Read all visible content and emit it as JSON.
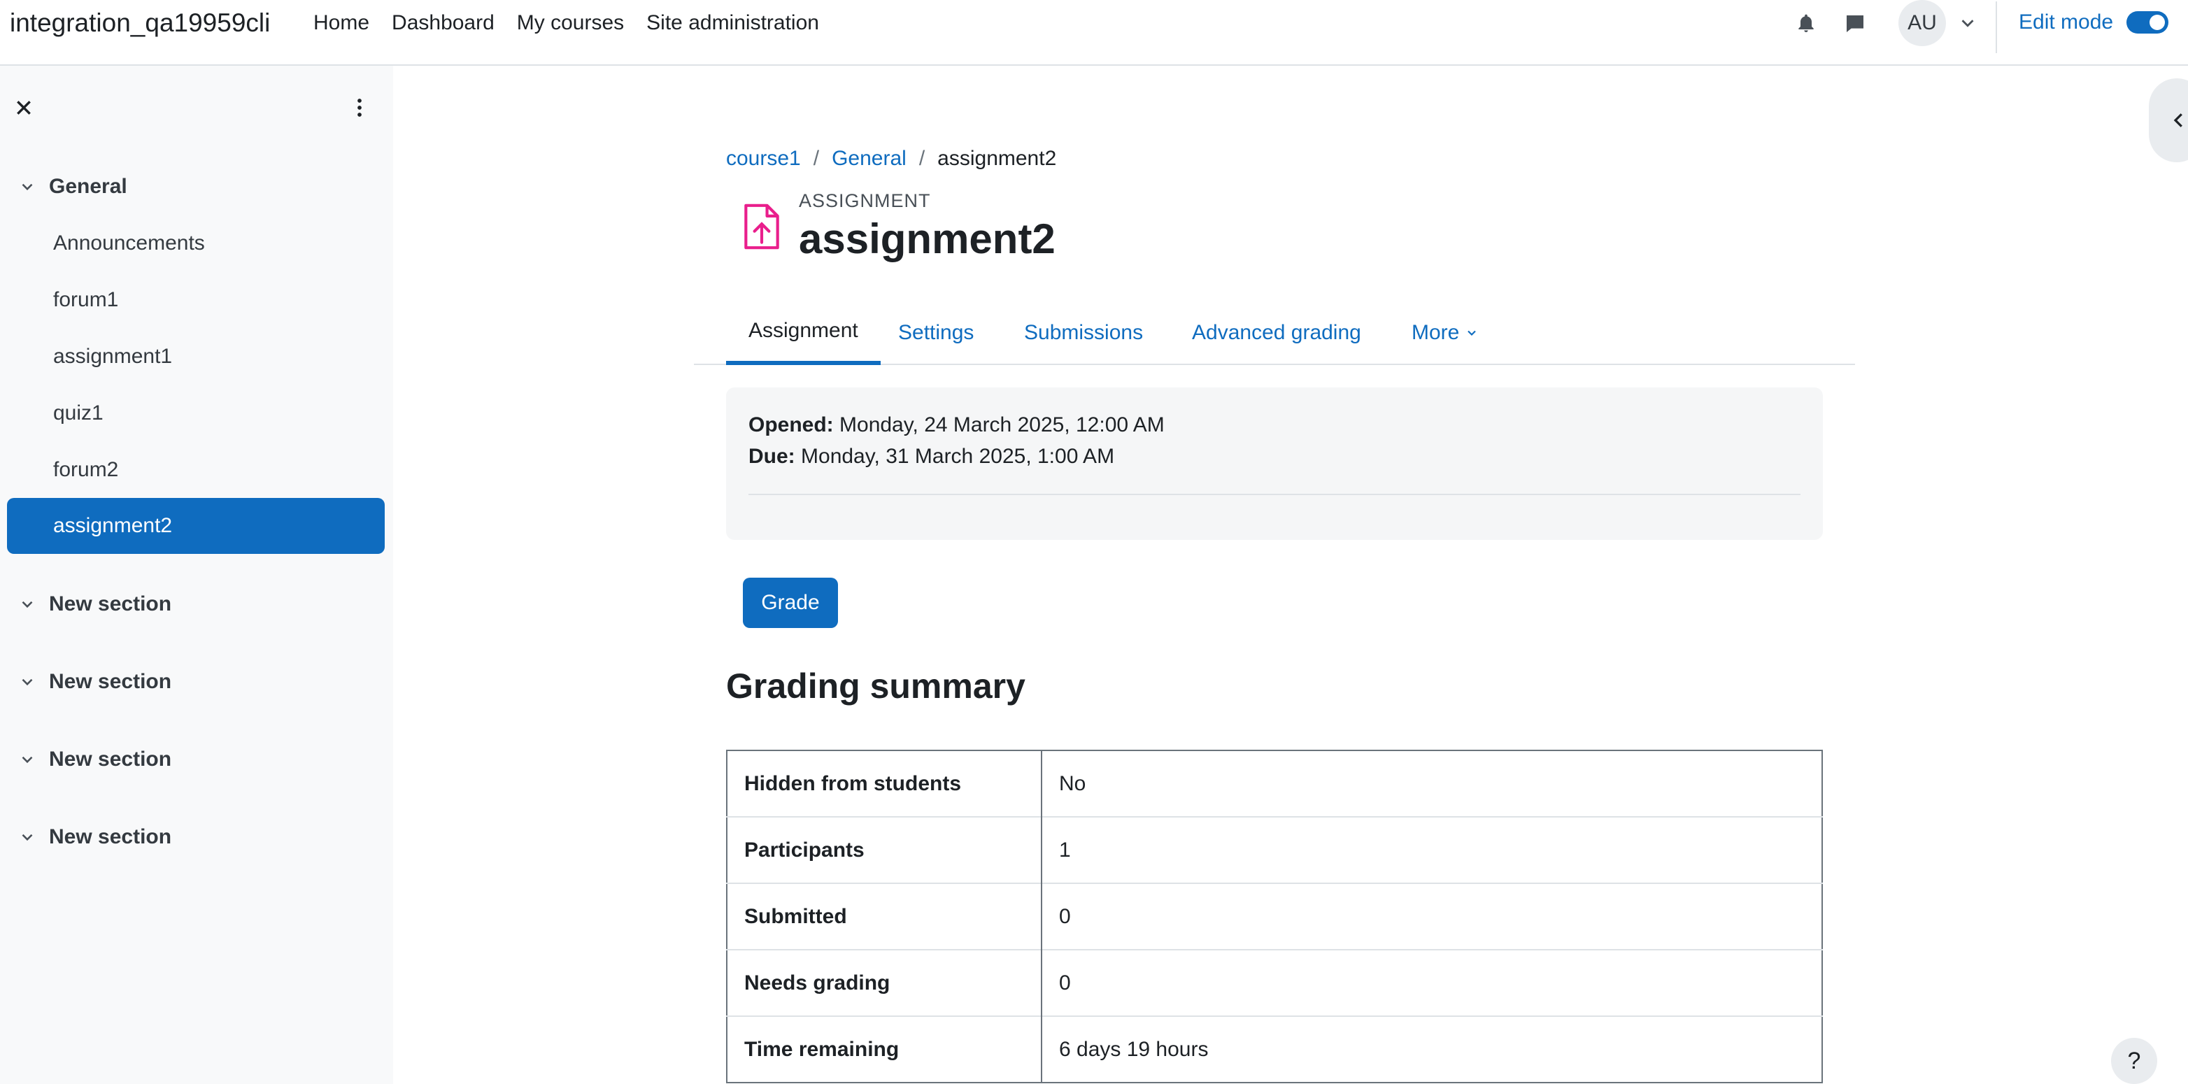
{
  "header": {
    "site_name": "integration_qa19959cli",
    "nav": [
      "Home",
      "Dashboard",
      "My courses",
      "Site administration"
    ],
    "avatar_initials": "AU",
    "edit_mode_label": "Edit mode",
    "edit_mode_on": true
  },
  "drawer": {
    "sections": [
      {
        "title": "General",
        "items": [
          "Announcements",
          "forum1",
          "assignment1",
          "quiz1",
          "forum2",
          "assignment2"
        ],
        "active_item": "assignment2"
      },
      {
        "title": "New section"
      },
      {
        "title": "New section"
      },
      {
        "title": "New section"
      },
      {
        "title": "New section"
      }
    ]
  },
  "breadcrumb": {
    "items": [
      "course1",
      "General"
    ],
    "current": "assignment2"
  },
  "activity": {
    "type_label": "ASSIGNMENT",
    "title": "assignment2"
  },
  "tabs": {
    "items": [
      "Assignment",
      "Settings",
      "Submissions",
      "Advanced grading",
      "More"
    ],
    "active": "Assignment"
  },
  "dates": {
    "opened_label": "Opened:",
    "opened_value": "Monday, 24 March 2025, 12:00 AM",
    "due_label": "Due:",
    "due_value": "Monday, 31 March 2025, 1:00 AM"
  },
  "grade_button": "Grade",
  "grading_summary": {
    "title": "Grading summary",
    "rows": [
      {
        "label": "Hidden from students",
        "value": "No"
      },
      {
        "label": "Participants",
        "value": "1"
      },
      {
        "label": "Submitted",
        "value": "0"
      },
      {
        "label": "Needs grading",
        "value": "0"
      },
      {
        "label": "Time remaining",
        "value": "6 days 19 hours"
      }
    ]
  },
  "help_label": "?",
  "colors": {
    "primary": "#0f6cbf",
    "activity_icon": "#e91e8c",
    "drawer_bg": "#f8f9fa"
  },
  "icons": [
    "bell-icon",
    "chat-icon",
    "close-icon",
    "kebab-icon",
    "chevron-down-icon",
    "upload-file-icon",
    "chevron-left-icon",
    "help-icon"
  ]
}
